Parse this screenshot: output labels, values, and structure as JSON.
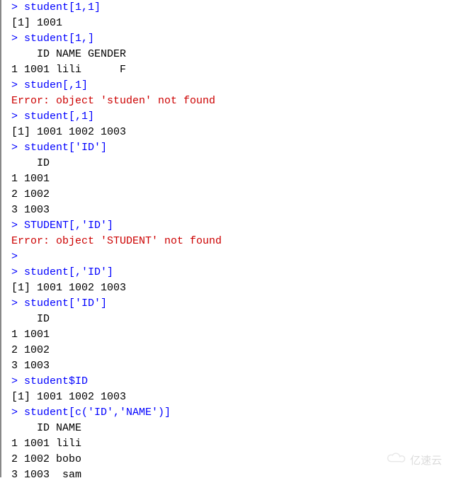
{
  "lines": [
    {
      "type": "cmd",
      "prompt": "> ",
      "text": "student[1,1]"
    },
    {
      "type": "out",
      "text": "[1] 1001"
    },
    {
      "type": "cmd",
      "prompt": "> ",
      "text": "student[1,]"
    },
    {
      "type": "out",
      "text": "    ID NAME GENDER"
    },
    {
      "type": "out",
      "text": "1 1001 lili      F"
    },
    {
      "type": "cmd",
      "prompt": "> ",
      "text": "studen[,1]"
    },
    {
      "type": "err",
      "text": "Error: object 'studen' not found"
    },
    {
      "type": "cmd",
      "prompt": "> ",
      "text": "student[,1]"
    },
    {
      "type": "out",
      "text": "[1] 1001 1002 1003"
    },
    {
      "type": "cmd",
      "prompt": "> ",
      "text": "student['ID']"
    },
    {
      "type": "out",
      "text": "    ID"
    },
    {
      "type": "out",
      "text": "1 1001"
    },
    {
      "type": "out",
      "text": "2 1002"
    },
    {
      "type": "out",
      "text": "3 1003"
    },
    {
      "type": "cmd",
      "prompt": "> ",
      "text": "STUDENT[,'ID']"
    },
    {
      "type": "err",
      "text": "Error: object 'STUDENT' not found"
    },
    {
      "type": "cmd",
      "prompt": "> ",
      "text": ""
    },
    {
      "type": "cmd",
      "prompt": "> ",
      "text": "student[,'ID']"
    },
    {
      "type": "out",
      "text": "[1] 1001 1002 1003"
    },
    {
      "type": "cmd",
      "prompt": "> ",
      "text": "student['ID']"
    },
    {
      "type": "out",
      "text": "    ID"
    },
    {
      "type": "out",
      "text": "1 1001"
    },
    {
      "type": "out",
      "text": "2 1002"
    },
    {
      "type": "out",
      "text": "3 1003"
    },
    {
      "type": "cmd",
      "prompt": "> ",
      "text": "student$ID"
    },
    {
      "type": "out",
      "text": "[1] 1001 1002 1003"
    },
    {
      "type": "cmd",
      "prompt": "> ",
      "text": "student[c('ID','NAME')]"
    },
    {
      "type": "out",
      "text": "    ID NAME"
    },
    {
      "type": "out",
      "text": "1 1001 lili"
    },
    {
      "type": "out",
      "text": "2 1002 bobo"
    },
    {
      "type": "out",
      "text": "3 1003  sam"
    }
  ],
  "watermark": {
    "text": "亿速云"
  }
}
